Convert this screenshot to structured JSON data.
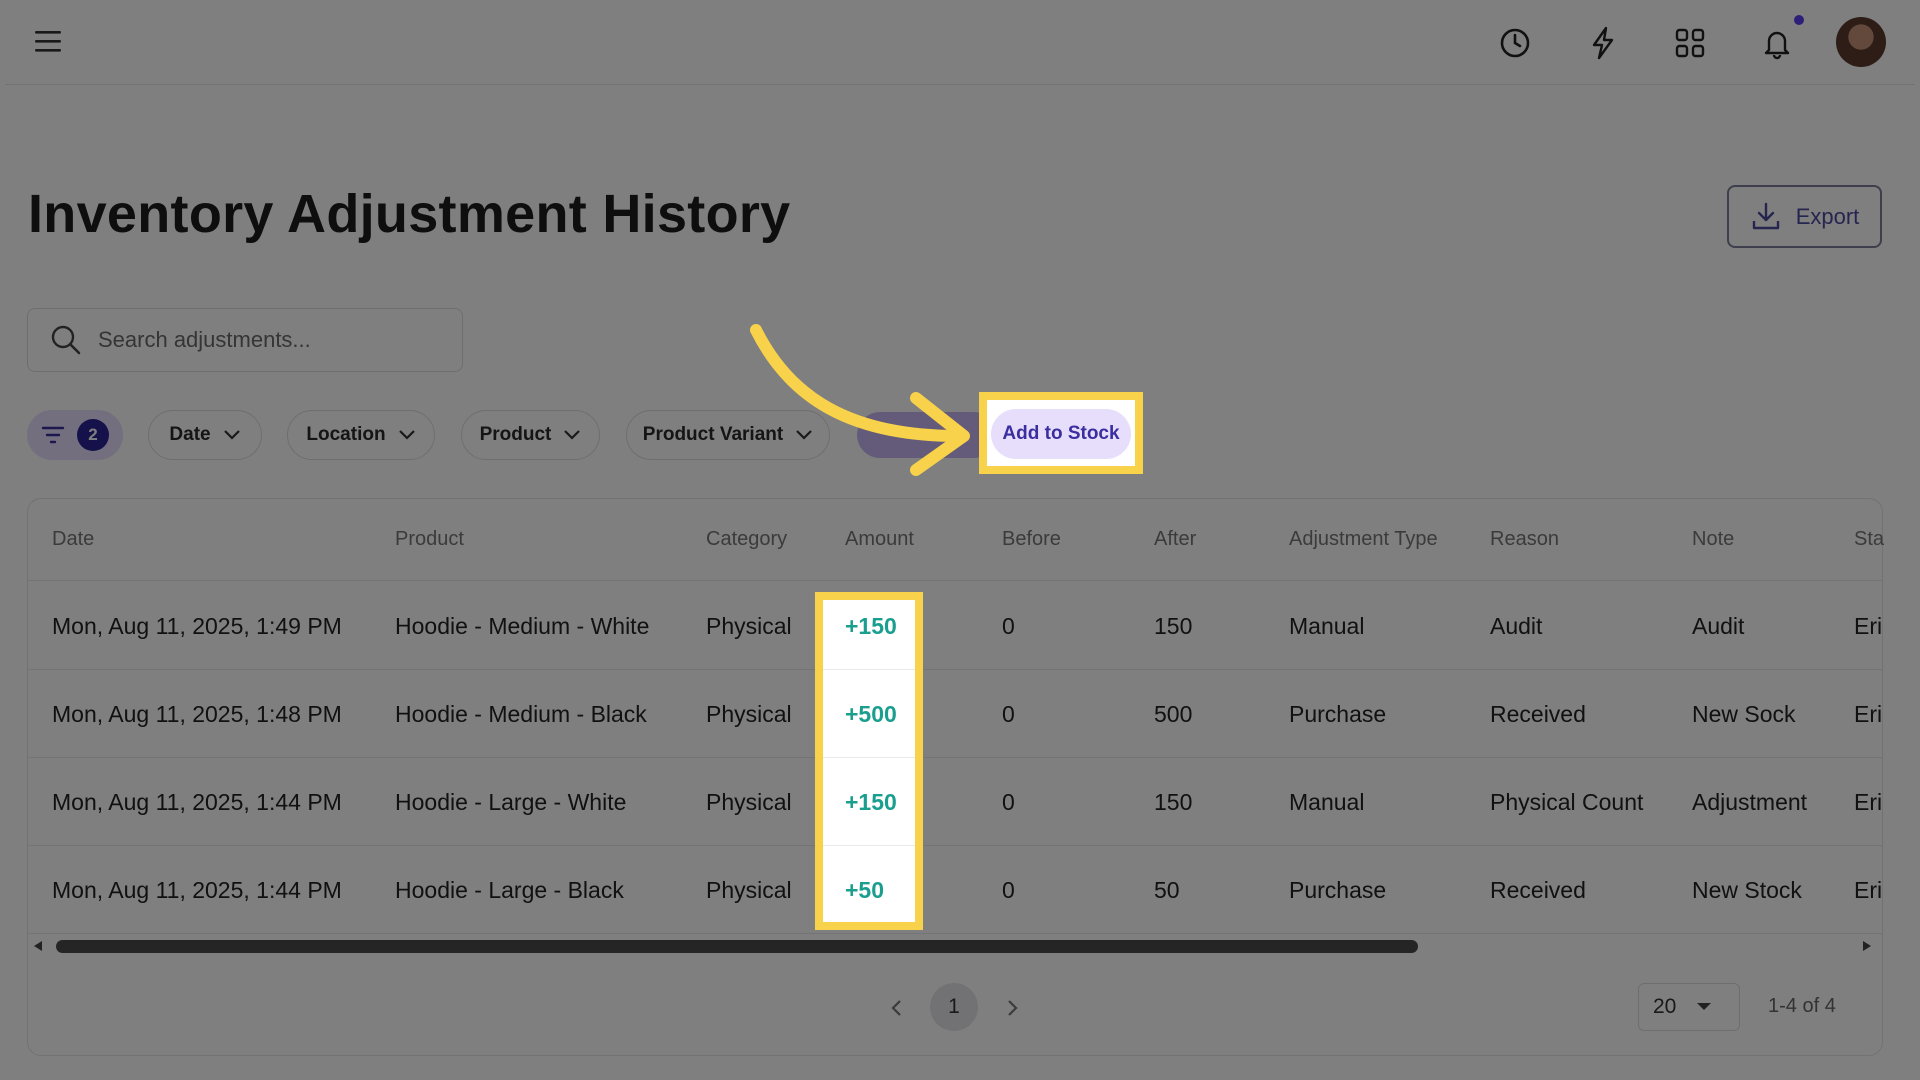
{
  "page": {
    "title": "Inventory Adjustment History",
    "export_label": "Export"
  },
  "search": {
    "placeholder": "Search adjustments..."
  },
  "filters": {
    "active_count": "2",
    "chips": [
      "Date",
      "Location",
      "Product",
      "Product Variant"
    ],
    "highlighted_chip": "Add to Stock"
  },
  "table": {
    "columns": [
      "Date",
      "Product",
      "Category",
      "Amount",
      "Before",
      "After",
      "Adjustment Type",
      "Reason",
      "Note",
      "Sta"
    ],
    "rows": [
      {
        "date": "Mon, Aug 11, 2025, 1:49 PM",
        "product": "Hoodie - Medium - White",
        "category": "Physical",
        "amount": "+150",
        "before": "0",
        "after": "150",
        "type": "Manual",
        "reason": "Audit",
        "note": "Audit",
        "staff": "Eri"
      },
      {
        "date": "Mon, Aug 11, 2025, 1:48 PM",
        "product": "Hoodie - Medium - Black",
        "category": "Physical",
        "amount": "+500",
        "before": "0",
        "after": "500",
        "type": "Purchase",
        "reason": "Received",
        "note": "New Sock",
        "staff": "Eri"
      },
      {
        "date": "Mon, Aug 11, 2025, 1:44 PM",
        "product": "Hoodie - Large - White",
        "category": "Physical",
        "amount": "+150",
        "before": "0",
        "after": "150",
        "type": "Manual",
        "reason": "Physical Count",
        "note": "Adjustment",
        "staff": "Eri"
      },
      {
        "date": "Mon, Aug 11, 2025, 1:44 PM",
        "product": "Hoodie - Large - Black",
        "category": "Physical",
        "amount": "+50",
        "before": "0",
        "after": "50",
        "type": "Purchase",
        "reason": "Received",
        "note": "New Stock",
        "staff": "Eri"
      }
    ]
  },
  "pagination": {
    "current_page": "1",
    "page_size": "20",
    "range": "1-4 of 4"
  },
  "colors": {
    "accent": "#2a2396",
    "highlight": "#f8d24a",
    "amount_positive": "#1a9e8e",
    "chip_purple": "#e7defc"
  },
  "icons": [
    "menu-icon",
    "history-icon",
    "bolt-icon",
    "apps-grid-icon",
    "bell-icon",
    "avatar",
    "download-icon",
    "search-icon",
    "filter-icon",
    "chevron-down-icon",
    "arrow-annotation",
    "chevron-left-icon",
    "chevron-right-icon",
    "caret-down-icon"
  ]
}
